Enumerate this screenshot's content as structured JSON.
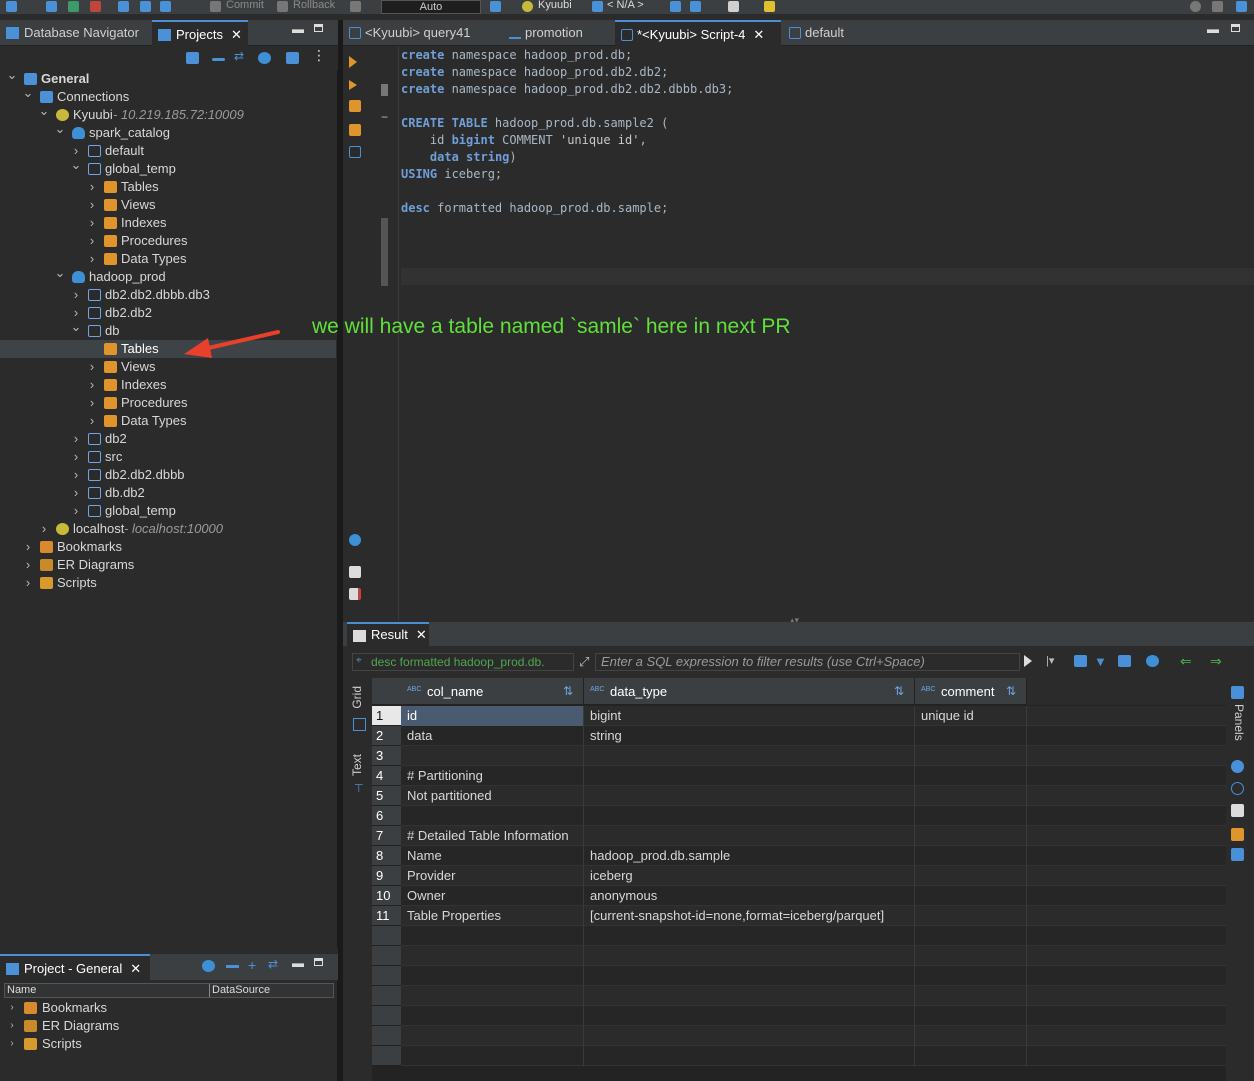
{
  "toolbar": {
    "commit": "Commit",
    "rollback": "Rollback",
    "mode": "Auto",
    "connection": "Kyuubi",
    "schema": "< N/A >"
  },
  "nav": {
    "tab_db_navigator": "Database Navigator",
    "tab_projects": "Projects",
    "tree": [
      {
        "label": "General",
        "sub": "",
        "level": 0,
        "icon": "general",
        "chev": "v",
        "bold": true
      },
      {
        "label": "Connections",
        "sub": "",
        "level": 1,
        "icon": "conn",
        "chev": "v"
      },
      {
        "label": "Kyuubi",
        "sub": " - 10.219.185.72:10009",
        "level": 2,
        "icon": "kyuubi",
        "chev": "v"
      },
      {
        "label": "spark_catalog",
        "sub": "",
        "level": 3,
        "icon": "db",
        "chev": "v"
      },
      {
        "label": "default",
        "sub": "",
        "level": 4,
        "icon": "schema",
        "chev": ">"
      },
      {
        "label": "global_temp",
        "sub": "",
        "level": 4,
        "icon": "schema",
        "chev": "v"
      },
      {
        "label": "Tables",
        "sub": "",
        "level": 5,
        "icon": "folder",
        "chev": ">"
      },
      {
        "label": "Views",
        "sub": "",
        "level": 5,
        "icon": "folder",
        "chev": ">"
      },
      {
        "label": "Indexes",
        "sub": "",
        "level": 5,
        "icon": "folder",
        "chev": ">"
      },
      {
        "label": "Procedures",
        "sub": "",
        "level": 5,
        "icon": "folder",
        "chev": ">"
      },
      {
        "label": "Data Types",
        "sub": "",
        "level": 5,
        "icon": "folder",
        "chev": ">"
      },
      {
        "label": "hadoop_prod",
        "sub": "",
        "level": 3,
        "icon": "db",
        "chev": "v"
      },
      {
        "label": "db2.db2.dbbb.db3",
        "sub": "",
        "level": 4,
        "icon": "schema",
        "chev": ">"
      },
      {
        "label": "db2.db2",
        "sub": "",
        "level": 4,
        "icon": "schema",
        "chev": ">"
      },
      {
        "label": "db",
        "sub": "",
        "level": 4,
        "icon": "schema",
        "chev": "v"
      },
      {
        "label": "Tables",
        "sub": "",
        "level": 5,
        "icon": "folder",
        "chev": "",
        "selected": true
      },
      {
        "label": "Views",
        "sub": "",
        "level": 5,
        "icon": "folder",
        "chev": ">"
      },
      {
        "label": "Indexes",
        "sub": "",
        "level": 5,
        "icon": "folder",
        "chev": ">"
      },
      {
        "label": "Procedures",
        "sub": "",
        "level": 5,
        "icon": "folder",
        "chev": ">"
      },
      {
        "label": "Data Types",
        "sub": "",
        "level": 5,
        "icon": "folder",
        "chev": ">"
      },
      {
        "label": "db2",
        "sub": "",
        "level": 4,
        "icon": "schema",
        "chev": ">"
      },
      {
        "label": "src",
        "sub": "",
        "level": 4,
        "icon": "schema",
        "chev": ">"
      },
      {
        "label": "db2.db2.dbbb",
        "sub": "",
        "level": 4,
        "icon": "schema",
        "chev": ">"
      },
      {
        "label": "db.db2",
        "sub": "",
        "level": 4,
        "icon": "schema",
        "chev": ">"
      },
      {
        "label": "global_temp",
        "sub": "",
        "level": 4,
        "icon": "schema",
        "chev": ">"
      },
      {
        "label": "localhost",
        "sub": " - localhost:10000",
        "level": 2,
        "icon": "kyuubi",
        "chev": ">"
      },
      {
        "label": "Bookmarks",
        "sub": "",
        "level": 1,
        "icon": "book",
        "chev": ">"
      },
      {
        "label": "ER Diagrams",
        "sub": "",
        "level": 1,
        "icon": "er",
        "chev": ">"
      },
      {
        "label": "Scripts",
        "sub": "",
        "level": 1,
        "icon": "scripts",
        "chev": ">"
      }
    ]
  },
  "project_panel": {
    "tab": "Project - General",
    "col_name": "Name",
    "col_datasource": "DataSource",
    "items": [
      "Bookmarks",
      "ER Diagrams",
      "Scripts"
    ]
  },
  "editor": {
    "tabs": [
      "<Kyuubi> query41",
      "promotion",
      "*<Kyuubi> Script-4",
      "default"
    ],
    "active_tab": 2,
    "lines": [
      [
        [
          "kw",
          "create"
        ],
        [
          "plain",
          " namespace hadoop_prod.db;"
        ]
      ],
      [
        [
          "kw",
          "create"
        ],
        [
          "plain",
          " namespace hadoop_prod.db2.db2;"
        ]
      ],
      [
        [
          "kw",
          "create"
        ],
        [
          "plain",
          " namespace hadoop_prod.db2.db2.dbbb.db3;"
        ]
      ],
      [],
      [
        [
          "kw",
          "CREATE TABLE"
        ],
        [
          "plain",
          " hadoop_prod.db.sample2 ("
        ]
      ],
      [
        [
          "plain",
          "    id "
        ],
        [
          "kw",
          "bigint"
        ],
        [
          "plain",
          " COMMENT "
        ],
        [
          "str",
          "'unique id'"
        ],
        [
          "plain",
          ","
        ]
      ],
      [
        [
          "plain",
          "    "
        ],
        [
          "kw",
          "data"
        ],
        [
          "plain",
          " "
        ],
        [
          "kw",
          "string"
        ],
        [
          "plain",
          ")"
        ]
      ],
      [
        [
          "kw",
          "USING"
        ],
        [
          "plain",
          " iceberg;"
        ]
      ],
      [],
      [
        [
          "kw",
          "desc"
        ],
        [
          "plain",
          " formatted hadoop_prod.db.sample;"
        ]
      ]
    ]
  },
  "annotation": "we will have a table named `samle` here in next PR",
  "result": {
    "tab": "Result",
    "query_label": "desc formatted hadoop_prod.db.",
    "filter_placeholder": "Enter a SQL expression to filter results (use Ctrl+Space)",
    "side_tabs": [
      "Grid",
      "Text"
    ],
    "panels_label": "Panels",
    "columns": [
      "col_name",
      "data_type",
      "comment"
    ],
    "rows": [
      [
        "id",
        "bigint",
        "unique id"
      ],
      [
        "data",
        "string",
        ""
      ],
      [
        "",
        "",
        ""
      ],
      [
        "# Partitioning",
        "",
        ""
      ],
      [
        "Not partitioned",
        "",
        ""
      ],
      [
        "",
        "",
        ""
      ],
      [
        "# Detailed Table Information",
        "",
        ""
      ],
      [
        "Name",
        "hadoop_prod.db.sample",
        ""
      ],
      [
        "Provider",
        "iceberg",
        ""
      ],
      [
        "Owner",
        "anonymous",
        ""
      ],
      [
        "Table Properties",
        "[current-snapshot-id=none,format=iceberg/parquet]",
        ""
      ]
    ]
  },
  "colors": {
    "accent": "#4a8fd4",
    "annotation": "#5fe03a",
    "arrow": "#e8402a",
    "keyword": "#6f9fd8"
  }
}
